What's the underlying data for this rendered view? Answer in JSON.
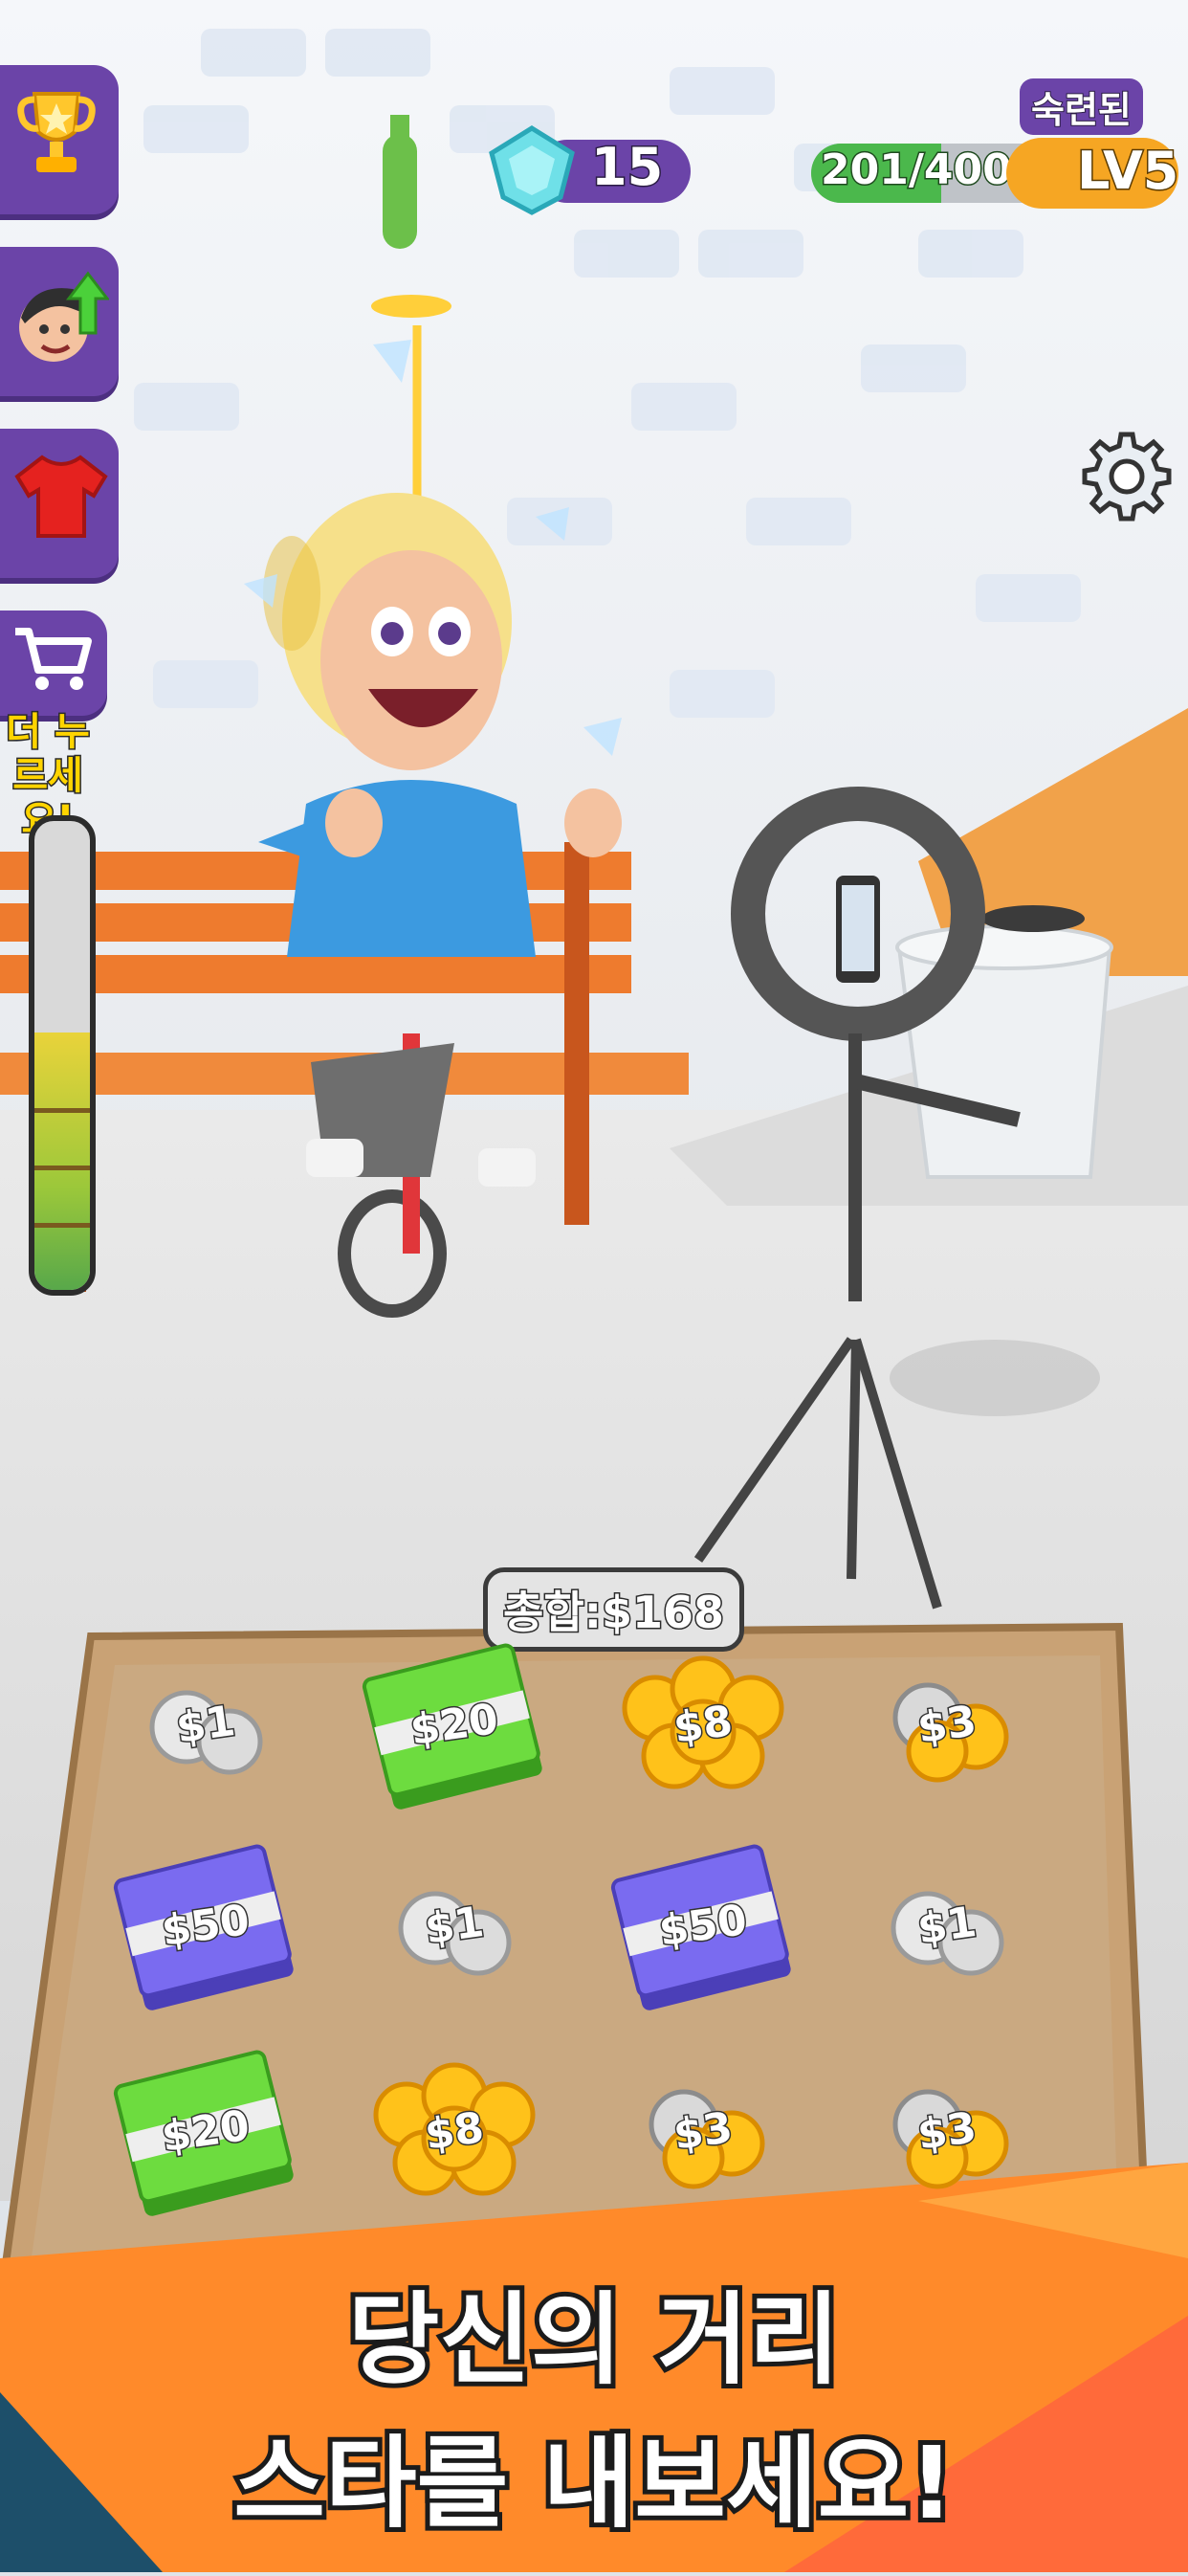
{
  "gems": {
    "count": "15"
  },
  "level": {
    "rank": "숙련된",
    "xp": "201/400",
    "xp_fraction": 0.5025,
    "label": "LV5"
  },
  "side_menu": {
    "items": [
      {
        "icon": "trophy-icon"
      },
      {
        "icon": "upgrade-character-icon"
      },
      {
        "icon": "outfit-shirt-icon"
      },
      {
        "icon": "shopping-cart-icon"
      }
    ],
    "hint": "더 누르세요!"
  },
  "power_meter": {
    "level": 0.55
  },
  "tip_jar": {
    "total": "총합:$168",
    "rows": [
      [
        "$1",
        "$20",
        "$8",
        "$3"
      ],
      [
        "$50",
        "$1",
        "$50",
        "$1"
      ],
      [
        "$20",
        "$8",
        "$3",
        "$3"
      ]
    ]
  },
  "banner": {
    "line1": "당신의 거리",
    "line2": "스타를 내보세요!"
  },
  "colors": {
    "menu_purple": "#6b44a8",
    "xp_green": "#4bb84c",
    "level_orange": "#f6a623",
    "banner_orange": "#ff8a2a"
  }
}
